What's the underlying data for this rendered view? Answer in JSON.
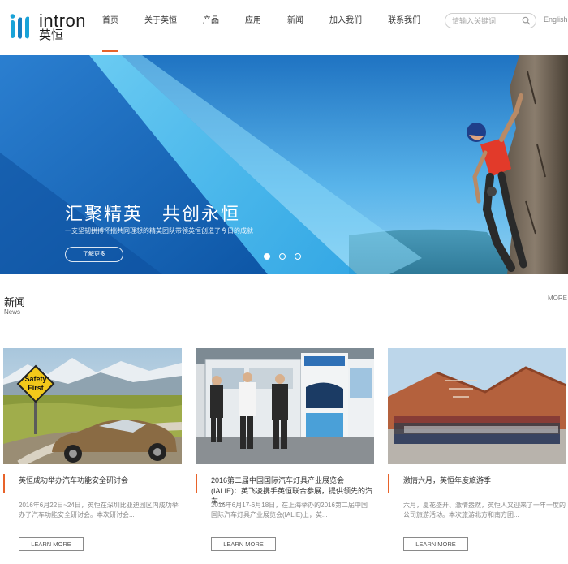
{
  "logo": {
    "en": "intron",
    "cn": "英恒"
  },
  "nav": [
    {
      "label": "首页"
    },
    {
      "label": "关于英恒"
    },
    {
      "label": "产品"
    },
    {
      "label": "应用"
    },
    {
      "label": "新闻"
    },
    {
      "label": "加入我们"
    },
    {
      "label": "联系我们"
    }
  ],
  "search": {
    "placeholder": "请输入关键词"
  },
  "lang": "English",
  "banner": {
    "title": "汇聚精英　共创永恒",
    "subtitle": "一支坚韧拼搏怀揣共同理想的精英团队带领英恒创造了今日的成就",
    "button": "了解更多"
  },
  "news": {
    "title": "新闻",
    "subtitle": "News",
    "more": "MORE",
    "items": [
      {
        "title": "英恒成功举办汽车功能安全研讨会",
        "desc": "2016年6月22日~24日，英恒在深圳比亚迪园区内成功举办了汽车功能安全研讨会。本次研讨会...",
        "button": "LEARN MORE",
        "sign_text": "Safety First"
      },
      {
        "title": "2016第二届中国国际汽车灯具产业展览会(IALIE)：英飞凌携手英恒联合参展，提供领先的汽车...",
        "desc": "2016年6月17-6月18日，在上海举办的2016第二届中国国际汽车灯具产业展览会(IALIE)上，英...",
        "button": "LEARN MORE"
      },
      {
        "title": "激情六月，英恒年度旅游季",
        "desc": "六月，夏花盛开、激情盎然，英恒人又迎来了一年一度的公司旅游活动。本次旅游北方和南方团...",
        "button": "LEARN MORE"
      }
    ]
  },
  "colors": {
    "accent": "#e8632a",
    "banner_blue": "#1a86cf"
  }
}
